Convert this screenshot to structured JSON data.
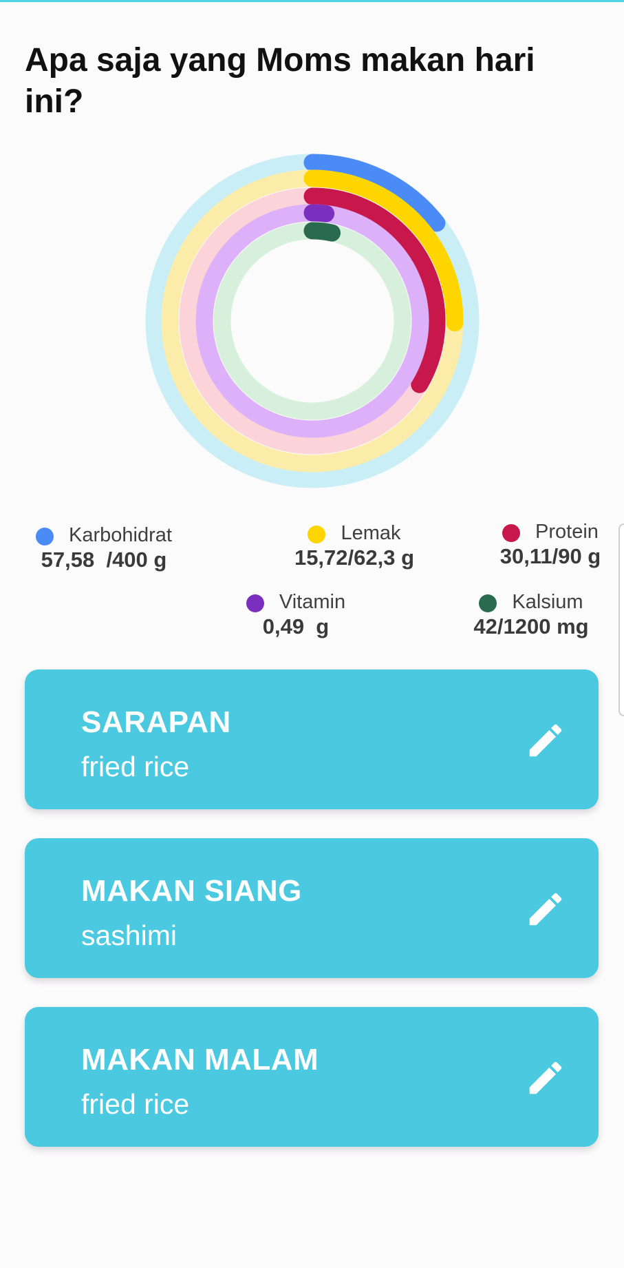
{
  "page": {
    "title": "Apa saja yang Moms makan hari ini?"
  },
  "colors": {
    "accent": "#4ac9e1",
    "karbohidrat": "#4b8bf5",
    "lemak": "#ffd500",
    "protein": "#c8174a",
    "vitamin": "#7b2fbf",
    "kalsium": "#2a6b4f"
  },
  "nutrients": [
    {
      "key": "karbohidrat",
      "label": "Karbohidrat",
      "value": "57,58  /400 g",
      "consumed": 57.58,
      "target": 400,
      "progress": 0.144,
      "color": "#4b8bf5",
      "track": "#c9eef6"
    },
    {
      "key": "lemak",
      "label": "Lemak",
      "value": "15,72/62,3 g",
      "consumed": 15.72,
      "target": 62.3,
      "progress": 0.252,
      "color": "#ffd500",
      "track": "#fcecaa"
    },
    {
      "key": "protein",
      "label": "Protein",
      "value": "30,11/90 g",
      "consumed": 30.11,
      "target": 90,
      "progress": 0.335,
      "color": "#c8174a",
      "track": "#fdd3da"
    },
    {
      "key": "vitamin",
      "label": "Vitamin",
      "value": "0,49  g",
      "consumed": 0.49,
      "progress": 0.02,
      "color": "#7b2fbf",
      "track": "#ddb0fa"
    },
    {
      "key": "kalsium",
      "label": "Kalsium",
      "value": "42/1200 mg",
      "consumed": 42,
      "target": 1200,
      "progress": 0.035,
      "color": "#2a6b4f",
      "track": "#d7f0dc"
    }
  ],
  "meals": [
    {
      "title": "SARAPAN",
      "food": "fried rice",
      "icon": "pencil-icon"
    },
    {
      "title": "MAKAN SIANG",
      "food": "sashimi",
      "icon": "pencil-icon"
    },
    {
      "title": "MAKAN MALAM",
      "food": "fried rice",
      "icon": "pencil-icon"
    }
  ]
}
